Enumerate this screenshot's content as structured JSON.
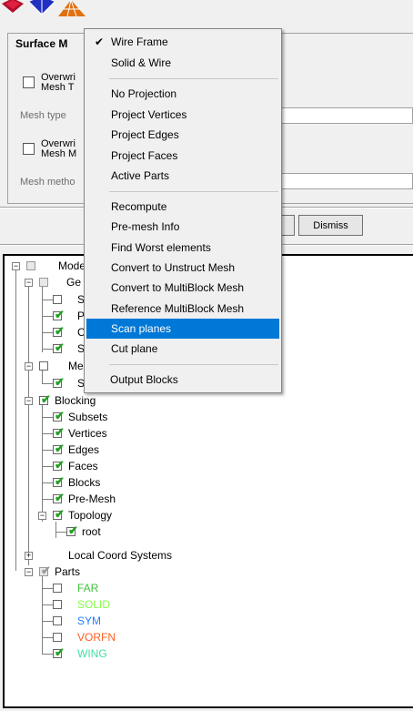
{
  "toolbar": {
    "icons": [
      "solid-cube-icon",
      "wire-cube-icon",
      "surface-mesh-icon"
    ]
  },
  "panel": {
    "title": "Surface M",
    "overwrite_template_line1": "Overwri",
    "overwrite_template_line2": "Mesh T",
    "mesh_type_label": "Mesh type",
    "overwrite_method_line1": "Overwri",
    "overwrite_method_line2": "Mesh M",
    "mesh_method_label": "Mesh metho",
    "dismiss_label": "Dismiss"
  },
  "menu": {
    "items": [
      {
        "label": "Wire Frame",
        "checked": true
      },
      {
        "label": "Solid & Wire"
      },
      {
        "label": "No Projection"
      },
      {
        "label": "Project Vertices"
      },
      {
        "label": "Project Edges"
      },
      {
        "label": "Project Faces"
      },
      {
        "label": "Active Parts"
      },
      {
        "label": "Recompute"
      },
      {
        "label": "Pre-mesh Info"
      },
      {
        "label": "Find Worst elements"
      },
      {
        "label": "Convert to Unstruct Mesh"
      },
      {
        "label": "Convert to MultiBlock Mesh"
      },
      {
        "label": "Reference MultiBlock Mesh"
      },
      {
        "label": "Scan planes",
        "highlighted": true
      },
      {
        "label": "Cut plane"
      },
      {
        "label": "Output Blocks"
      }
    ]
  },
  "tree": {
    "model": "Mode",
    "geometry": "Ge",
    "geom_children": [
      "S",
      "P",
      "C",
      "S"
    ],
    "mesh": "Me",
    "mesh_children": [
      "S"
    ],
    "blocking": "Blocking",
    "blocking_children": [
      "Subsets",
      "Vertices",
      "Edges",
      "Faces",
      "Blocks",
      "Pre-Mesh"
    ],
    "topology": "Topology",
    "root": "root",
    "local_coord": "Local Coord Systems",
    "parts": "Parts",
    "parts_children": [
      "FAR",
      "SOLID",
      "SYM",
      "VORFN",
      "WING"
    ],
    "part_colors": [
      "#40c040",
      "#80ff40",
      "#2080ff",
      "#ff6020",
      "#40e0a0"
    ]
  }
}
